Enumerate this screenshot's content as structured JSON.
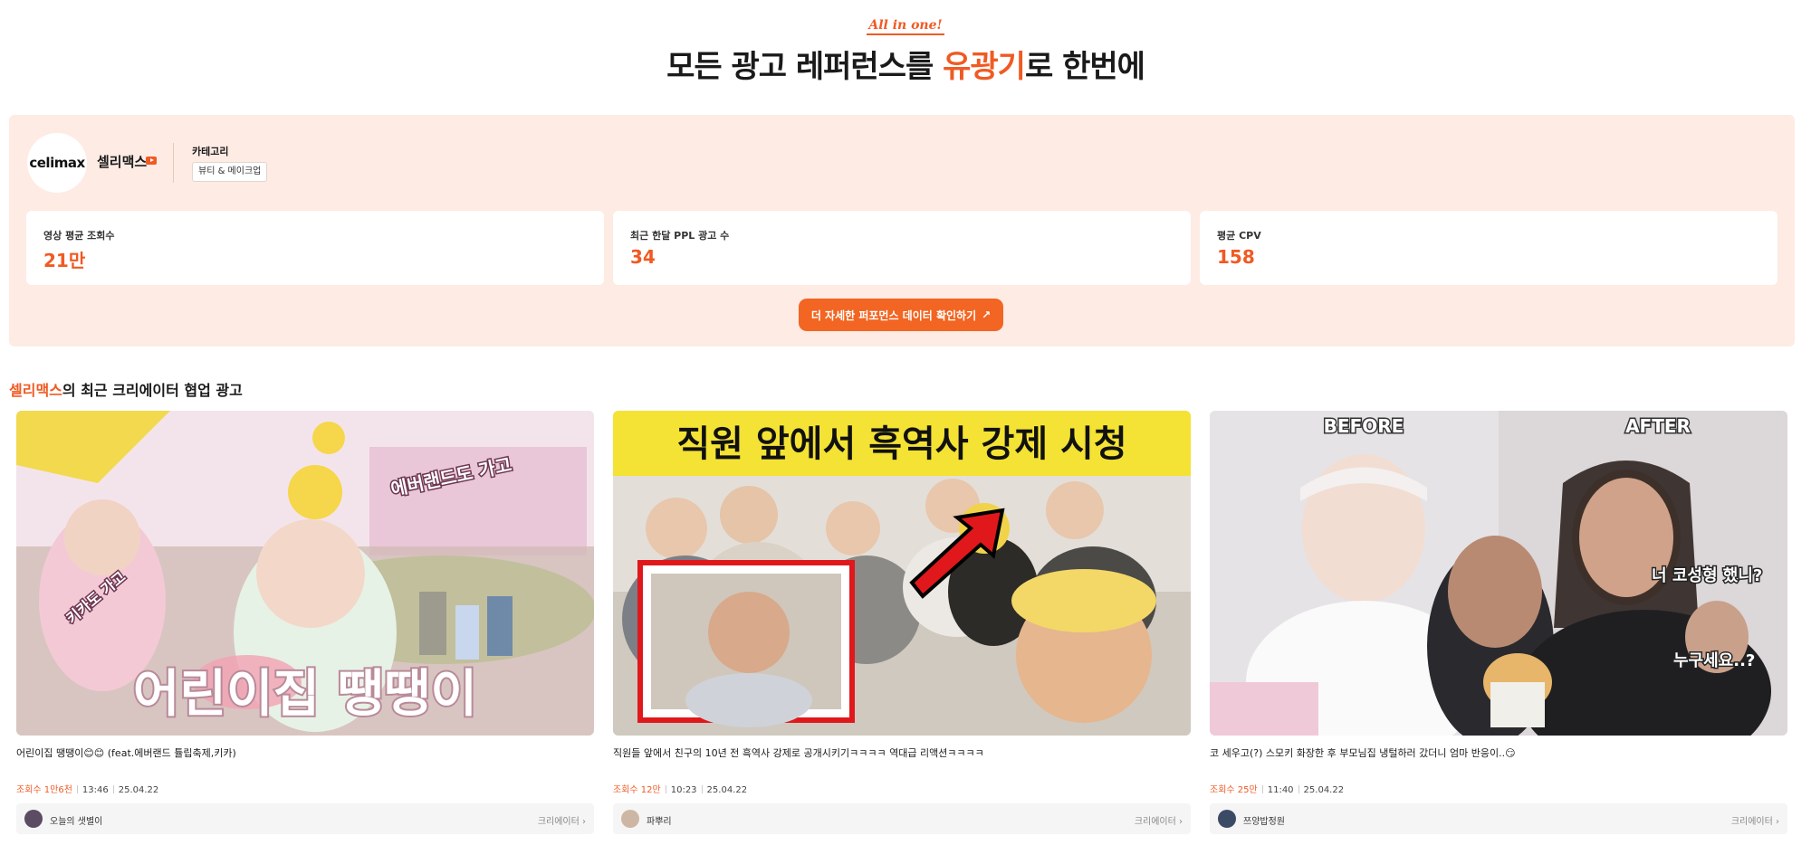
{
  "header": {
    "tagline": "All in one!",
    "title_pre": "모든 광고 레퍼런스를 ",
    "title_highlight": "유광기",
    "title_post": "로 한번에"
  },
  "brand": {
    "logo_text": "celimax",
    "name": "셀리맥스",
    "category_label": "카테고리",
    "category_value": "뷰티 & 메이크업"
  },
  "stats": [
    {
      "label": "영상 평균 조회수",
      "value": "21만"
    },
    {
      "label": "최근 한달 PPL 광고 수",
      "value": "34"
    },
    {
      "label": "평균 CPV",
      "value": "158"
    }
  ],
  "cta_label": "더 자세한 퍼포먼스 데이터 확인하기",
  "section": {
    "brand": "셀리맥스",
    "rest": "의 최근 크리에이터 협업 광고"
  },
  "videos": [
    {
      "thumb_caption": "어린이집 땡땡이",
      "thumb_tag1": "에버랜드도 가고",
      "thumb_tag2": "키카도 가고",
      "title": "어린이집 땡땡이😊😊 (feat.에버랜드 튤립축제,키카)",
      "views": "조회수 1만6천",
      "duration": "13:46",
      "date": "25.04.22",
      "creator": "오늘의 샛별이",
      "creator_link": "크리에이터 ›"
    },
    {
      "thumb_caption": "직원 앞에서 흑역사 강제 시청",
      "title": "직원들 앞에서 친구의 10년 전 흑역사 강제로 공개시키기ㅋㅋㅋㅋ 역대급 리액션ㅋㅋㅋㅋ",
      "views": "조회수 12만",
      "duration": "10:23",
      "date": "25.04.22",
      "creator": "파뿌리",
      "creator_link": "크리에이터 ›"
    },
    {
      "thumb_before": "BEFORE",
      "thumb_after": "AFTER",
      "thumb_q1": "너 코성형 했니?",
      "thumb_q2": "누구세요..?",
      "title": "코 세우고(?) 스모키 화장한 후 부모님집 냉털하러 갔더니 엄마 반응이..😏",
      "views": "조회수 25만",
      "duration": "11:40",
      "date": "25.04.22",
      "creator": "쯔양밥정원",
      "creator_link": "크리에이터 ›"
    }
  ],
  "colors": {
    "accent": "#f05a23",
    "panel_bg": "#fdebe4"
  }
}
